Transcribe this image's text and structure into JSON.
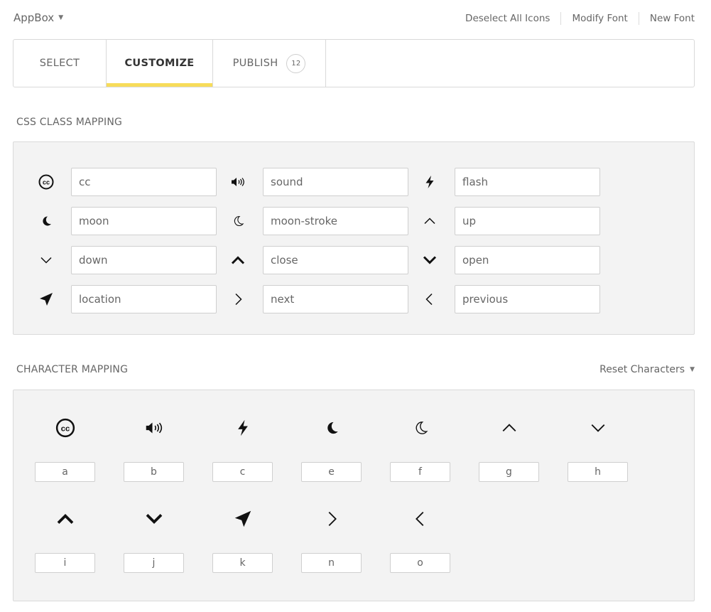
{
  "app": {
    "title": "AppBox"
  },
  "toplinks": {
    "deselect": "Deselect All Icons",
    "modify": "Modify Font",
    "new_font": "New Font"
  },
  "tabs": [
    {
      "label": "SELECT"
    },
    {
      "label": "CUSTOMIZE"
    },
    {
      "label": "PUBLISH",
      "badge": "12"
    }
  ],
  "css_mapping": {
    "title": "CSS CLASS MAPPING",
    "rows": [
      [
        {
          "icon": "cc-icon",
          "value": "cc"
        },
        {
          "icon": "sound-icon",
          "value": "sound"
        },
        {
          "icon": "flash-icon",
          "value": "flash"
        }
      ],
      [
        {
          "icon": "moon-icon",
          "value": "moon"
        },
        {
          "icon": "moon-stroke-icon",
          "value": "moon-stroke"
        },
        {
          "icon": "up-icon",
          "value": "up"
        }
      ],
      [
        {
          "icon": "down-icon",
          "value": "down"
        },
        {
          "icon": "close-icon",
          "value": "close"
        },
        {
          "icon": "open-icon",
          "value": "open"
        }
      ],
      [
        {
          "icon": "location-icon",
          "value": "location"
        },
        {
          "icon": "next-icon",
          "value": "next"
        },
        {
          "icon": "previous-icon",
          "value": "previous"
        }
      ]
    ]
  },
  "char_mapping": {
    "title": "CHARACTER MAPPING",
    "reset_label": "Reset Characters",
    "rows": [
      [
        {
          "icon": "cc-icon",
          "char": "a"
        },
        {
          "icon": "sound-icon",
          "char": "b"
        },
        {
          "icon": "flash-icon",
          "char": "c"
        },
        {
          "icon": "moon-icon",
          "char": "e"
        },
        {
          "icon": "moon-stroke-icon",
          "char": "f"
        },
        {
          "icon": "up-icon",
          "char": "g"
        },
        {
          "icon": "down-icon",
          "char": "h"
        }
      ],
      [
        {
          "icon": "close-icon",
          "char": "i"
        },
        {
          "icon": "open-icon",
          "char": "j"
        },
        {
          "icon": "location-icon",
          "char": "k"
        },
        {
          "icon": "next-icon",
          "char": "n"
        },
        {
          "icon": "previous-icon",
          "char": "o"
        }
      ]
    ]
  }
}
